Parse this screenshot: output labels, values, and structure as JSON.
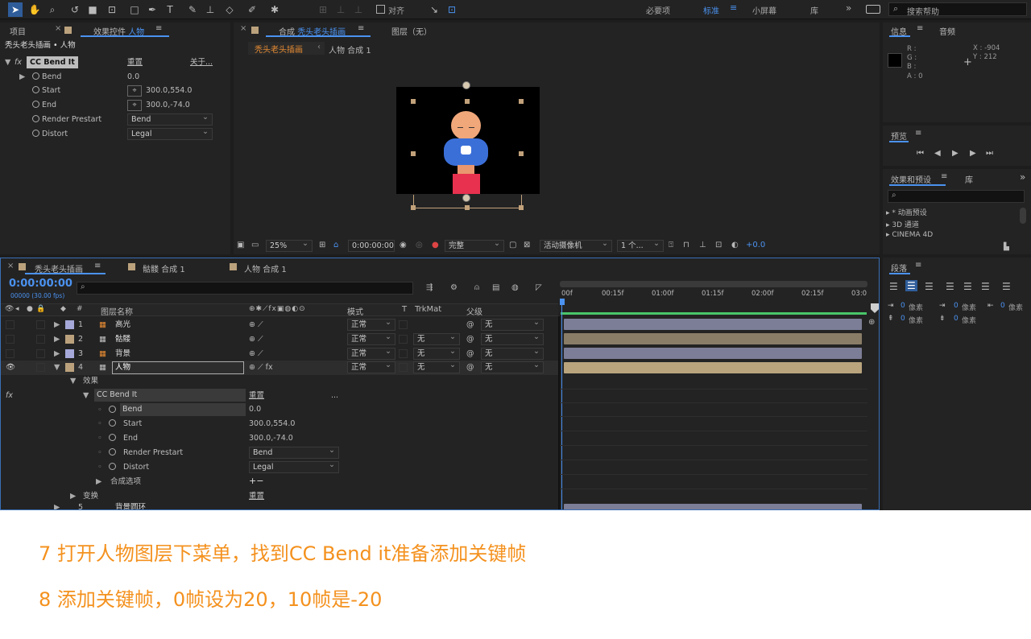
{
  "toolbar": {
    "align_label": "对齐",
    "workspaces": [
      "必要项",
      "标准",
      "小屏幕",
      "库"
    ],
    "active_workspace": "标准",
    "search_placeholder": "搜索帮助"
  },
  "project_panel": {
    "tab_project": "项目",
    "tab_effect_controls": "效果控件",
    "effect_layer": "人物",
    "breadcrumb": "秃头老头插画 • 人物",
    "effect_name": "CC Bend It",
    "reset_label": "重置",
    "about_label": "关于...",
    "props": [
      {
        "name": "Bend",
        "value": "0.0"
      },
      {
        "name": "Start",
        "value": "300.0,554.0"
      },
      {
        "name": "End",
        "value": "300.0,-74.0"
      },
      {
        "name": "Render Prestart",
        "value": "Bend"
      },
      {
        "name": "Distort",
        "value": "Legal"
      }
    ]
  },
  "composition": {
    "tab_label": "合成",
    "comp_name": "秃头老头插画",
    "layer_tab": "图层（无）",
    "crumb_active": "秃头老头插画",
    "crumb_child": "人物 合成 1",
    "zoom": "25%",
    "timecode": "0:00:00:00",
    "quality": "完整",
    "camera": "活动摄像机",
    "views": "1 个...",
    "exposure": "+0.0"
  },
  "info": {
    "tab_info": "信息",
    "tab_audio": "音频",
    "r": "R :",
    "g": "G :",
    "b": "B :",
    "a": "A : 0",
    "x": "X : -904",
    "y": "Y : 212"
  },
  "preview": {
    "title": "预览"
  },
  "effects_presets": {
    "title": "效果和预设",
    "library": "库",
    "items": [
      "* 动画预设",
      "3D 通道",
      "CINEMA 4D"
    ]
  },
  "timeline": {
    "tabs": [
      "秃头老头插画",
      "骷髅 合成 1",
      "人物 合成 1"
    ],
    "timecode": "0:00:00:00",
    "fps": "00000 (30.00 fps)",
    "col_name": "图层名称",
    "col_mode": "模式",
    "col_t": "T",
    "col_trkmat": "TrkMat",
    "col_parent": "父级",
    "ruler": [
      "00f",
      "00:15f",
      "01:00f",
      "01:15f",
      "02:00f",
      "02:15f",
      "03:0"
    ],
    "layers": [
      {
        "num": "1",
        "name": "高光",
        "mode": "正常",
        "trkmat": "",
        "parent": "无",
        "color": "#a5a8d8"
      },
      {
        "num": "2",
        "name": "骷髅",
        "mode": "正常",
        "trkmat": "无",
        "parent": "无",
        "color": "#bba27d"
      },
      {
        "num": "3",
        "name": "背景",
        "mode": "正常",
        "trkmat": "无",
        "parent": "无",
        "color": "#a5a8d8"
      },
      {
        "num": "4",
        "name": "人物",
        "mode": "正常",
        "trkmat": "无",
        "parent": "无",
        "color": "#bba27d"
      }
    ],
    "effects_label": "效果",
    "effect_name": "CC Bend It",
    "reset_label": "重置",
    "dots": "...",
    "props": [
      {
        "name": "Bend",
        "value": "0.0"
      },
      {
        "name": "Start",
        "value": "300.0,554.0"
      },
      {
        "name": "End",
        "value": "300.0,-74.0"
      },
      {
        "name": "Render Prestart",
        "value": "Bend"
      },
      {
        "name": "Distort",
        "value": "Legal"
      }
    ],
    "composite_options": "合成选项",
    "composite_value": "+−",
    "transform": "变换",
    "transform_reset": "重置",
    "layer5_num": "5",
    "layer5_name": "背景圆环"
  },
  "paragraph": {
    "title": "段落",
    "unit": "像素",
    "values": [
      "0",
      "0",
      "0",
      "0",
      "0"
    ]
  },
  "captions": [
    "7 打开人物图层下菜单，找到CC Bend it准备添加关键帧",
    "8 添加关键帧，0帧设为20，10帧是-20"
  ]
}
